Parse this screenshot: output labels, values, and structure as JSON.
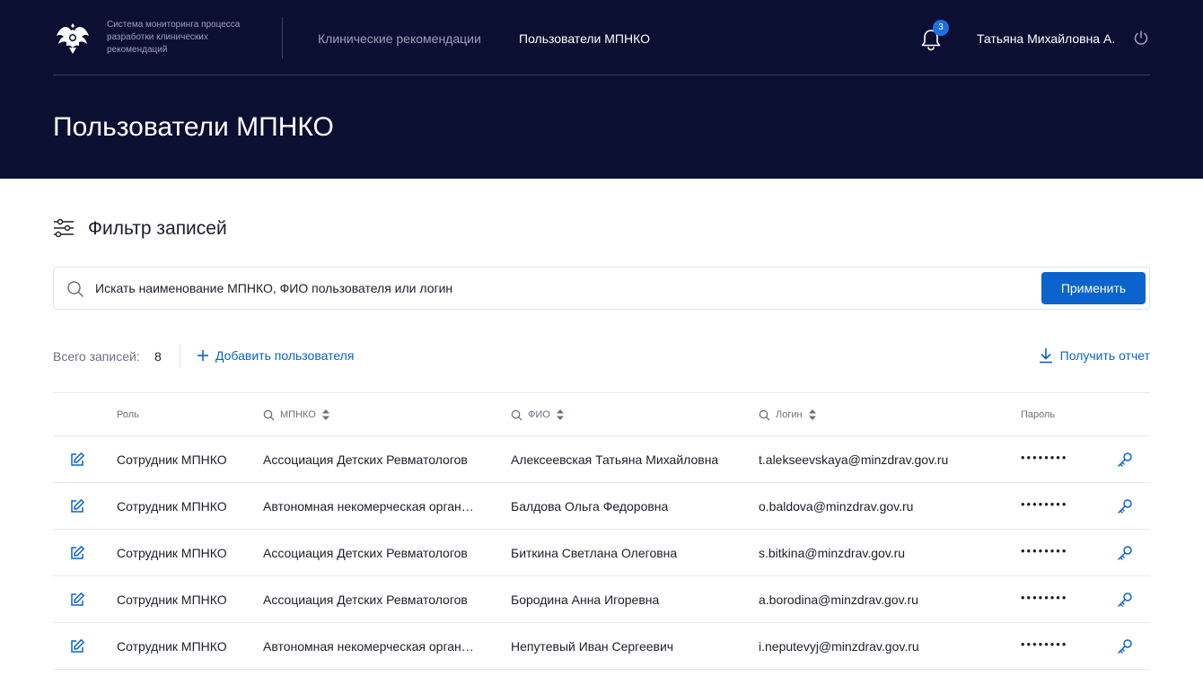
{
  "header": {
    "system_name": "Система мониторинга процесса разработки клинических рекомендаций",
    "nav": [
      {
        "label": "Клинические рекомендации"
      },
      {
        "label": "Пользователи МПНКО"
      }
    ],
    "notifications_count": "3",
    "user_name": "Татьяна Михайловна А.",
    "page_title": "Пользователи МПНКО"
  },
  "filter": {
    "title": "Фильтр записей",
    "search_placeholder": "Искать наименование МПНКО, ФИО пользователя или логин",
    "apply_label": "Применить"
  },
  "toolbar": {
    "total_label": "Всего записей:",
    "total_value": "8",
    "add_user_label": "Добавить пользователя",
    "report_label": "Получить отчет"
  },
  "table": {
    "columns": {
      "role": "Роль",
      "org": "МПНКО",
      "fio": "ФИО",
      "login": "Логин",
      "password": "Пароль"
    },
    "rows": [
      {
        "role": "Сотрудник МПНКО",
        "org": "Ассоциация Детских Ревматологов",
        "fio": "Алексеевская Татьяна Михайловна",
        "login": "t.alekseevskaya@minzdrav.gov.ru",
        "password": "••••••••"
      },
      {
        "role": "Сотрудник МПНКО",
        "org": "Автономная некомерческая орган…",
        "fio": "Балдова Ольга Федоровна",
        "login": "o.baldova@minzdrav.gov.ru",
        "password": "••••••••"
      },
      {
        "role": "Сотрудник МПНКО",
        "org": "Ассоциация Детских Ревматологов",
        "fio": "Биткина Светлана Олеговна",
        "login": "s.bitkina@minzdrav.gov.ru",
        "password": "••••••••"
      },
      {
        "role": "Сотрудник МПНКО",
        "org": "Ассоциация Детских Ревматологов",
        "fio": "Бородина Анна Игоревна",
        "login": "a.borodina@minzdrav.gov.ru",
        "password": "••••••••"
      },
      {
        "role": "Сотрудник МПНКО",
        "org": "Автономная некомерческая орган…",
        "fio": "Непутевый Иван Сергеевич",
        "login": "i.neputevyj@minzdrav.gov.ru",
        "password": "••••••••"
      }
    ]
  },
  "colors": {
    "header_bg": "#0b1033",
    "accent": "#0b63ce",
    "badge": "#1e6fe0"
  }
}
